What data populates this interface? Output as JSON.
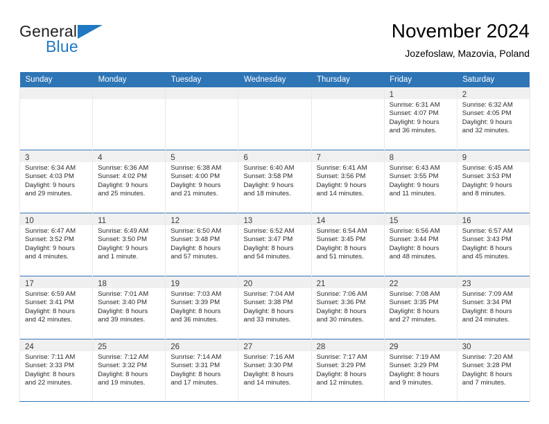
{
  "brand": {
    "name_part1": "General",
    "name_part2": "Blue",
    "flag_icon": "triangle-flag-icon",
    "accent_color": "#1f78c1"
  },
  "header": {
    "title": "November 2024",
    "subtitle": "Jozefoslaw, Mazovia, Poland"
  },
  "theme": {
    "header_blue": "#2e75b6",
    "daynum_band": "#f0f0f0",
    "cell_border": "#e8e8e8"
  },
  "calendar": {
    "day_headers": [
      "Sunday",
      "Monday",
      "Tuesday",
      "Wednesday",
      "Thursday",
      "Friday",
      "Saturday"
    ],
    "weeks": [
      [
        {
          "day": "",
          "empty": true
        },
        {
          "day": "",
          "empty": true
        },
        {
          "day": "",
          "empty": true
        },
        {
          "day": "",
          "empty": true
        },
        {
          "day": "",
          "empty": true
        },
        {
          "day": "1",
          "sunrise": "Sunrise: 6:31 AM",
          "sunset": "Sunset: 4:07 PM",
          "daylight_1": "Daylight: 9 hours",
          "daylight_2": "and 36 minutes."
        },
        {
          "day": "2",
          "sunrise": "Sunrise: 6:32 AM",
          "sunset": "Sunset: 4:05 PM",
          "daylight_1": "Daylight: 9 hours",
          "daylight_2": "and 32 minutes."
        }
      ],
      [
        {
          "day": "3",
          "sunrise": "Sunrise: 6:34 AM",
          "sunset": "Sunset: 4:03 PM",
          "daylight_1": "Daylight: 9 hours",
          "daylight_2": "and 29 minutes."
        },
        {
          "day": "4",
          "sunrise": "Sunrise: 6:36 AM",
          "sunset": "Sunset: 4:02 PM",
          "daylight_1": "Daylight: 9 hours",
          "daylight_2": "and 25 minutes."
        },
        {
          "day": "5",
          "sunrise": "Sunrise: 6:38 AM",
          "sunset": "Sunset: 4:00 PM",
          "daylight_1": "Daylight: 9 hours",
          "daylight_2": "and 21 minutes."
        },
        {
          "day": "6",
          "sunrise": "Sunrise: 6:40 AM",
          "sunset": "Sunset: 3:58 PM",
          "daylight_1": "Daylight: 9 hours",
          "daylight_2": "and 18 minutes."
        },
        {
          "day": "7",
          "sunrise": "Sunrise: 6:41 AM",
          "sunset": "Sunset: 3:56 PM",
          "daylight_1": "Daylight: 9 hours",
          "daylight_2": "and 14 minutes."
        },
        {
          "day": "8",
          "sunrise": "Sunrise: 6:43 AM",
          "sunset": "Sunset: 3:55 PM",
          "daylight_1": "Daylight: 9 hours",
          "daylight_2": "and 11 minutes."
        },
        {
          "day": "9",
          "sunrise": "Sunrise: 6:45 AM",
          "sunset": "Sunset: 3:53 PM",
          "daylight_1": "Daylight: 9 hours",
          "daylight_2": "and 8 minutes."
        }
      ],
      [
        {
          "day": "10",
          "sunrise": "Sunrise: 6:47 AM",
          "sunset": "Sunset: 3:52 PM",
          "daylight_1": "Daylight: 9 hours",
          "daylight_2": "and 4 minutes."
        },
        {
          "day": "11",
          "sunrise": "Sunrise: 6:49 AM",
          "sunset": "Sunset: 3:50 PM",
          "daylight_1": "Daylight: 9 hours",
          "daylight_2": "and 1 minute."
        },
        {
          "day": "12",
          "sunrise": "Sunrise: 6:50 AM",
          "sunset": "Sunset: 3:48 PM",
          "daylight_1": "Daylight: 8 hours",
          "daylight_2": "and 57 minutes."
        },
        {
          "day": "13",
          "sunrise": "Sunrise: 6:52 AM",
          "sunset": "Sunset: 3:47 PM",
          "daylight_1": "Daylight: 8 hours",
          "daylight_2": "and 54 minutes."
        },
        {
          "day": "14",
          "sunrise": "Sunrise: 6:54 AM",
          "sunset": "Sunset: 3:45 PM",
          "daylight_1": "Daylight: 8 hours",
          "daylight_2": "and 51 minutes."
        },
        {
          "day": "15",
          "sunrise": "Sunrise: 6:56 AM",
          "sunset": "Sunset: 3:44 PM",
          "daylight_1": "Daylight: 8 hours",
          "daylight_2": "and 48 minutes."
        },
        {
          "day": "16",
          "sunrise": "Sunrise: 6:57 AM",
          "sunset": "Sunset: 3:43 PM",
          "daylight_1": "Daylight: 8 hours",
          "daylight_2": "and 45 minutes."
        }
      ],
      [
        {
          "day": "17",
          "sunrise": "Sunrise: 6:59 AM",
          "sunset": "Sunset: 3:41 PM",
          "daylight_1": "Daylight: 8 hours",
          "daylight_2": "and 42 minutes."
        },
        {
          "day": "18",
          "sunrise": "Sunrise: 7:01 AM",
          "sunset": "Sunset: 3:40 PM",
          "daylight_1": "Daylight: 8 hours",
          "daylight_2": "and 39 minutes."
        },
        {
          "day": "19",
          "sunrise": "Sunrise: 7:03 AM",
          "sunset": "Sunset: 3:39 PM",
          "daylight_1": "Daylight: 8 hours",
          "daylight_2": "and 36 minutes."
        },
        {
          "day": "20",
          "sunrise": "Sunrise: 7:04 AM",
          "sunset": "Sunset: 3:38 PM",
          "daylight_1": "Daylight: 8 hours",
          "daylight_2": "and 33 minutes."
        },
        {
          "day": "21",
          "sunrise": "Sunrise: 7:06 AM",
          "sunset": "Sunset: 3:36 PM",
          "daylight_1": "Daylight: 8 hours",
          "daylight_2": "and 30 minutes."
        },
        {
          "day": "22",
          "sunrise": "Sunrise: 7:08 AM",
          "sunset": "Sunset: 3:35 PM",
          "daylight_1": "Daylight: 8 hours",
          "daylight_2": "and 27 minutes."
        },
        {
          "day": "23",
          "sunrise": "Sunrise: 7:09 AM",
          "sunset": "Sunset: 3:34 PM",
          "daylight_1": "Daylight: 8 hours",
          "daylight_2": "and 24 minutes."
        }
      ],
      [
        {
          "day": "24",
          "sunrise": "Sunrise: 7:11 AM",
          "sunset": "Sunset: 3:33 PM",
          "daylight_1": "Daylight: 8 hours",
          "daylight_2": "and 22 minutes."
        },
        {
          "day": "25",
          "sunrise": "Sunrise: 7:12 AM",
          "sunset": "Sunset: 3:32 PM",
          "daylight_1": "Daylight: 8 hours",
          "daylight_2": "and 19 minutes."
        },
        {
          "day": "26",
          "sunrise": "Sunrise: 7:14 AM",
          "sunset": "Sunset: 3:31 PM",
          "daylight_1": "Daylight: 8 hours",
          "daylight_2": "and 17 minutes."
        },
        {
          "day": "27",
          "sunrise": "Sunrise: 7:16 AM",
          "sunset": "Sunset: 3:30 PM",
          "daylight_1": "Daylight: 8 hours",
          "daylight_2": "and 14 minutes."
        },
        {
          "day": "28",
          "sunrise": "Sunrise: 7:17 AM",
          "sunset": "Sunset: 3:29 PM",
          "daylight_1": "Daylight: 8 hours",
          "daylight_2": "and 12 minutes."
        },
        {
          "day": "29",
          "sunrise": "Sunrise: 7:19 AM",
          "sunset": "Sunset: 3:29 PM",
          "daylight_1": "Daylight: 8 hours",
          "daylight_2": "and 9 minutes."
        },
        {
          "day": "30",
          "sunrise": "Sunrise: 7:20 AM",
          "sunset": "Sunset: 3:28 PM",
          "daylight_1": "Daylight: 8 hours",
          "daylight_2": "and 7 minutes."
        }
      ]
    ]
  }
}
